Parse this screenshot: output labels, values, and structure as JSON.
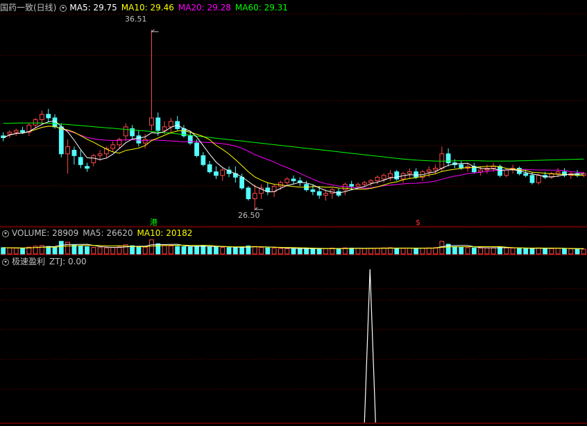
{
  "colors": {
    "up": "#ff4a4a",
    "down": "#54ffff",
    "ma5": "#ffffff",
    "ma10": "#ffff00",
    "ma20": "#ff00ff",
    "ma60": "#00ff00",
    "grid": "#8b0000",
    "text": "#c0c0c0"
  },
  "main_legend": {
    "title": "国药一致(日线)",
    "ma5": "MA5: 29.75",
    "ma10": "MA10: 29.46",
    "ma20": "MA20: 29.28",
    "ma60": "MA60: 29.31"
  },
  "vol_legend": {
    "title": "VOLUME: 28909",
    "ma5": "MA5: 26620",
    "ma10": "MA10: 20182"
  },
  "ind_legend": {
    "title": "极速盈利",
    "ztj": "ZTJ: 0.00"
  },
  "annotations": {
    "high": "36.51",
    "low": "26.50",
    "marker_gang": "港",
    "marker_dollar": "$"
  },
  "chart_data": {
    "type": "candlestick",
    "ylim": [
      26.0,
      37.0
    ],
    "grid": true,
    "candles": [
      [
        30.6,
        30.8,
        30.3,
        30.5
      ],
      [
        30.7,
        30.9,
        30.5,
        30.8
      ],
      [
        30.8,
        31.0,
        30.6,
        30.9
      ],
      [
        30.9,
        31.1,
        30.7,
        30.8
      ],
      [
        30.8,
        31.3,
        30.6,
        31.2
      ],
      [
        31.2,
        31.6,
        31.0,
        31.5
      ],
      [
        31.5,
        32.0,
        31.2,
        31.8
      ],
      [
        31.8,
        32.1,
        31.4,
        31.6
      ],
      [
        31.6,
        31.8,
        31.0,
        31.1
      ],
      [
        31.1,
        31.3,
        29.4,
        29.6
      ],
      [
        29.6,
        30.4,
        28.5,
        30.0
      ],
      [
        29.8,
        30.0,
        29.0,
        29.5
      ],
      [
        29.4,
        29.8,
        28.8,
        29.0
      ],
      [
        28.9,
        29.1,
        28.6,
        28.8
      ],
      [
        29.1,
        29.6,
        28.9,
        29.5
      ],
      [
        29.5,
        29.8,
        29.2,
        29.6
      ],
      [
        29.6,
        30.0,
        29.4,
        29.9
      ],
      [
        29.9,
        30.3,
        29.7,
        30.1
      ],
      [
        30.1,
        30.5,
        29.9,
        30.4
      ],
      [
        30.6,
        31.3,
        30.3,
        31.1
      ],
      [
        31.0,
        31.2,
        30.4,
        30.6
      ],
      [
        30.6,
        30.9,
        30.0,
        30.2
      ],
      [
        30.2,
        30.7,
        29.9,
        30.4
      ],
      [
        31.2,
        36.51,
        30.9,
        31.6
      ],
      [
        31.6,
        31.9,
        30.6,
        30.9
      ],
      [
        30.9,
        31.4,
        30.7,
        31.1
      ],
      [
        31.1,
        31.6,
        30.8,
        31.4
      ],
      [
        31.4,
        31.7,
        30.9,
        31.0
      ],
      [
        31.0,
        31.2,
        30.5,
        30.6
      ],
      [
        30.6,
        30.8,
        30.1,
        30.2
      ],
      [
        30.2,
        30.4,
        29.4,
        29.5
      ],
      [
        29.5,
        29.7,
        28.9,
        29.0
      ],
      [
        29.0,
        29.2,
        28.5,
        28.6
      ],
      [
        28.6,
        28.9,
        28.2,
        28.4
      ],
      [
        28.4,
        28.8,
        28.1,
        28.7
      ],
      [
        28.7,
        28.9,
        28.3,
        28.5
      ],
      [
        28.5,
        28.9,
        28.0,
        28.3
      ],
      [
        28.3,
        28.5,
        27.6,
        27.7
      ],
      [
        27.7,
        27.8,
        27.0,
        27.1
      ],
      [
        27.1,
        27.9,
        26.5,
        27.4
      ],
      [
        27.4,
        27.9,
        27.1,
        27.7
      ],
      [
        27.7,
        28.0,
        27.3,
        27.5
      ],
      [
        27.5,
        27.9,
        27.2,
        27.8
      ],
      [
        27.8,
        28.1,
        27.6,
        28.0
      ],
      [
        28.0,
        28.3,
        27.8,
        28.2
      ],
      [
        28.2,
        28.4,
        27.9,
        28.1
      ],
      [
        28.1,
        28.3,
        27.8,
        28.0
      ],
      [
        27.9,
        28.1,
        27.5,
        27.6
      ],
      [
        27.6,
        27.9,
        27.3,
        27.5
      ],
      [
        27.5,
        27.8,
        27.1,
        27.3
      ],
      [
        27.3,
        27.6,
        27.0,
        27.4
      ],
      [
        27.4,
        27.7,
        27.1,
        27.6
      ],
      [
        27.5,
        27.7,
        27.2,
        27.3
      ],
      [
        27.6,
        28.0,
        27.3,
        27.9
      ],
      [
        27.9,
        28.1,
        27.6,
        27.8
      ],
      [
        27.8,
        28.0,
        27.7,
        27.9
      ],
      [
        27.9,
        28.1,
        27.8,
        28.0
      ],
      [
        28.0,
        28.2,
        27.8,
        28.1
      ],
      [
        28.1,
        28.4,
        27.9,
        28.3
      ],
      [
        28.2,
        28.5,
        28.0,
        28.4
      ],
      [
        28.3,
        28.7,
        28.1,
        28.5
      ],
      [
        28.6,
        28.7,
        28.1,
        28.2
      ],
      [
        28.2,
        28.6,
        28.0,
        28.5
      ],
      [
        28.5,
        28.8,
        28.2,
        28.6
      ],
      [
        28.6,
        28.8,
        28.2,
        28.3
      ],
      [
        28.3,
        28.7,
        28.1,
        28.6
      ],
      [
        28.6,
        28.9,
        28.3,
        28.7
      ],
      [
        28.7,
        29.0,
        28.5,
        28.8
      ],
      [
        28.8,
        30.0,
        28.6,
        29.6
      ],
      [
        29.6,
        29.9,
        28.9,
        29.1
      ],
      [
        29.1,
        29.3,
        28.8,
        29.0
      ],
      [
        29.0,
        29.2,
        28.7,
        28.8
      ],
      [
        28.8,
        29.1,
        28.6,
        28.9
      ],
      [
        28.9,
        29.1,
        28.5,
        28.6
      ],
      [
        28.6,
        28.9,
        28.4,
        28.7
      ],
      [
        28.7,
        29.0,
        28.5,
        28.8
      ],
      [
        28.8,
        29.1,
        28.6,
        28.9
      ],
      [
        28.9,
        29.0,
        28.3,
        28.4
      ],
      [
        28.4,
        28.8,
        28.3,
        28.7
      ],
      [
        28.7,
        29.0,
        28.5,
        28.8
      ],
      [
        28.8,
        28.9,
        28.4,
        28.5
      ],
      [
        28.5,
        28.7,
        28.3,
        28.4
      ],
      [
        28.4,
        28.6,
        27.9,
        28.0
      ],
      [
        28.0,
        28.5,
        27.9,
        28.4
      ],
      [
        28.4,
        28.6,
        28.2,
        28.3
      ],
      [
        28.3,
        28.6,
        28.2,
        28.5
      ],
      [
        28.5,
        28.8,
        28.3,
        28.6
      ],
      [
        28.6,
        28.8,
        28.3,
        28.4
      ],
      [
        28.4,
        28.6,
        28.2,
        28.5
      ],
      [
        28.5,
        28.7,
        28.3,
        28.4
      ],
      [
        28.4,
        28.6,
        28.3,
        28.5
      ]
    ],
    "ma60": [
      31.3,
      31.3,
      31.31,
      31.32,
      31.32,
      31.32,
      31.31,
      31.3,
      31.28,
      31.26,
      31.23,
      31.2,
      31.17,
      31.14,
      31.11,
      31.08,
      31.05,
      31.02,
      30.99,
      30.96,
      30.93,
      30.9,
      30.87,
      30.84,
      30.81,
      30.78,
      30.75,
      30.71,
      30.67,
      30.63,
      30.59,
      30.55,
      30.51,
      30.47,
      30.43,
      30.39,
      30.35,
      30.31,
      30.27,
      30.23,
      30.19,
      30.15,
      30.11,
      30.07,
      30.03,
      29.99,
      29.95,
      29.91,
      29.87,
      29.83,
      29.79,
      29.75,
      29.71,
      29.67,
      29.63,
      29.59,
      29.55,
      29.51,
      29.47,
      29.43,
      29.39,
      29.35,
      29.31,
      29.28,
      29.25,
      29.23,
      29.21,
      29.2,
      29.19,
      29.2,
      29.21,
      29.22,
      29.22,
      29.22,
      29.21,
      29.2,
      29.2,
      29.2,
      29.2,
      29.2,
      29.21,
      29.22,
      29.23,
      29.24,
      29.25,
      29.26,
      29.27,
      29.28,
      29.29,
      29.3,
      29.31
    ]
  },
  "volume_data": {
    "max": 60000,
    "values": [
      26000,
      25000,
      24000,
      23000,
      28000,
      32000,
      35000,
      31000,
      28000,
      52000,
      48000,
      36000,
      33000,
      30000,
      27000,
      26000,
      25000,
      27000,
      29000,
      38000,
      34000,
      30000,
      28000,
      58000,
      42000,
      35000,
      33000,
      31000,
      30000,
      29000,
      32000,
      35000,
      30000,
      28000,
      27000,
      26000,
      27000,
      29000,
      33000,
      31000,
      27000,
      25000,
      24000,
      23000,
      22000,
      21000,
      22000,
      23000,
      22000,
      21000,
      22000,
      24000,
      21000,
      25000,
      24000,
      23000,
      22000,
      23000,
      24000,
      25000,
      26000,
      24000,
      23000,
      24000,
      23000,
      24000,
      25000,
      26000,
      52000,
      40000,
      30000,
      27000,
      26000,
      25000,
      24000,
      25000,
      26000,
      28000,
      25000,
      24000,
      22000,
      21000,
      24000,
      25000,
      23000,
      22000,
      23000,
      22000,
      21000,
      20000,
      20000
    ]
  },
  "indicator_data": {
    "ymax": 1,
    "spike_index": 56,
    "spike_value": 1
  }
}
